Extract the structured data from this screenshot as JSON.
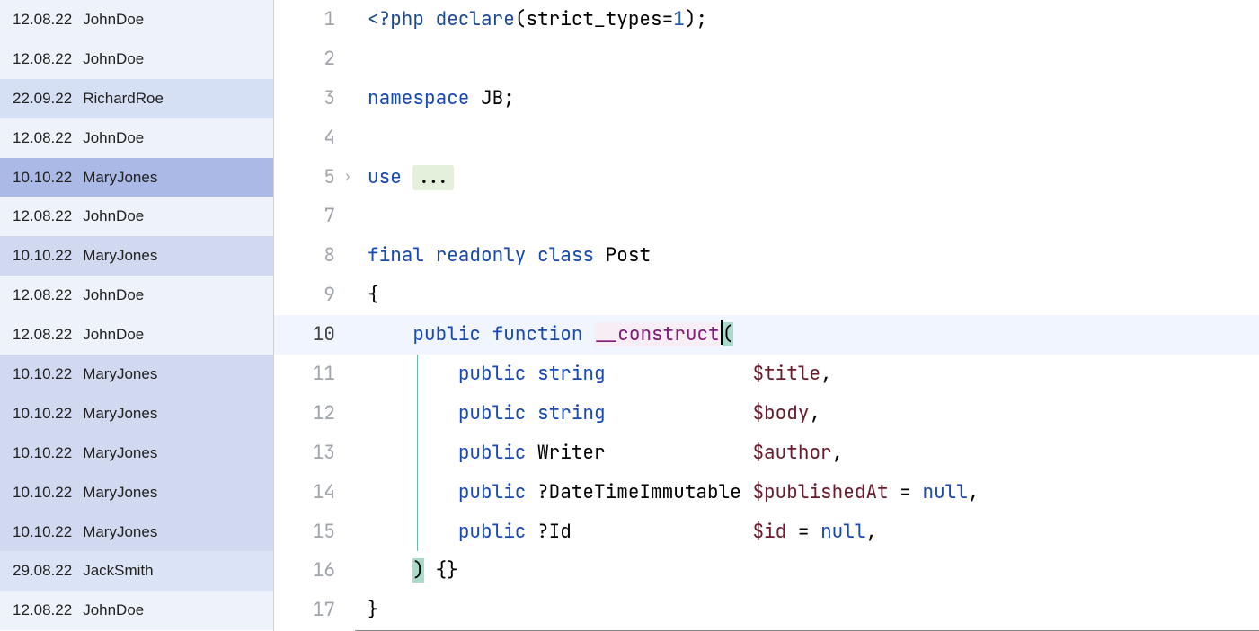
{
  "blame": [
    {
      "date": "12.08.22",
      "author": "JohnDoe",
      "shade": "shade-johndoe"
    },
    {
      "date": "12.08.22",
      "author": "JohnDoe",
      "shade": "shade-johndoe"
    },
    {
      "date": "22.09.22",
      "author": "RichardRoe",
      "shade": "shade-richard"
    },
    {
      "date": "12.08.22",
      "author": "JohnDoe",
      "shade": "shade-johndoe"
    },
    {
      "date": "10.10.22",
      "author": "MaryJones",
      "shade": "shade-mary-sel"
    },
    {
      "date": "12.08.22",
      "author": "JohnDoe",
      "shade": "shade-johndoe"
    },
    {
      "date": "10.10.22",
      "author": "MaryJones",
      "shade": "shade-mary"
    },
    {
      "date": "12.08.22",
      "author": "JohnDoe",
      "shade": "shade-johndoe"
    },
    {
      "date": "12.08.22",
      "author": "JohnDoe",
      "shade": "shade-johndoe"
    },
    {
      "date": "10.10.22",
      "author": "MaryJones",
      "shade": "shade-mary"
    },
    {
      "date": "10.10.22",
      "author": "MaryJones",
      "shade": "shade-mary"
    },
    {
      "date": "10.10.22",
      "author": "MaryJones",
      "shade": "shade-mary"
    },
    {
      "date": "10.10.22",
      "author": "MaryJones",
      "shade": "shade-mary"
    },
    {
      "date": "10.10.22",
      "author": "MaryJones",
      "shade": "shade-mary"
    },
    {
      "date": "29.08.22",
      "author": "JackSmith",
      "shade": "shade-jack"
    },
    {
      "date": "12.08.22",
      "author": "JohnDoe",
      "shade": "shade-johndoe"
    }
  ],
  "lines": {
    "l1": {
      "num": "1"
    },
    "l2": {
      "num": "2"
    },
    "l3": {
      "num": "3"
    },
    "l4": {
      "num": "4"
    },
    "l5": {
      "num": "5"
    },
    "l7": {
      "num": "7"
    },
    "l8": {
      "num": "8"
    },
    "l9": {
      "num": "9"
    },
    "l10": {
      "num": "10"
    },
    "l11": {
      "num": "11"
    },
    "l12": {
      "num": "12"
    },
    "l13": {
      "num": "13"
    },
    "l14": {
      "num": "14"
    },
    "l15": {
      "num": "15"
    },
    "l16": {
      "num": "16"
    },
    "l17": {
      "num": "17"
    }
  },
  "code": {
    "php_open": "<?php",
    "declare": "declare",
    "strict_types": "strict_types",
    "eq": "=",
    "one": "1",
    "close_paren_semi": ");",
    "namespace": "namespace",
    "ns_name": "JB",
    "semi": ";",
    "use": "use",
    "folded": "...",
    "final": "final",
    "readonly": "readonly",
    "class": "class",
    "class_name": "Post",
    "open_brace": "{",
    "public": "public",
    "function": "function",
    "construct": "__construct",
    "open_p": "(",
    "string": "string",
    "title": "$title",
    "comma": ",",
    "body": "$body",
    "writer": "Writer",
    "author": "$author",
    "nullable_dti": "?DateTimeImmutable",
    "publishedAt": "$publishedAt",
    "assign_null": " = ",
    "null": "null",
    "nullable_id": "?Id",
    "id": "$id",
    "close_p": ")",
    "empty_body": " {}",
    "close_brace": "}"
  }
}
